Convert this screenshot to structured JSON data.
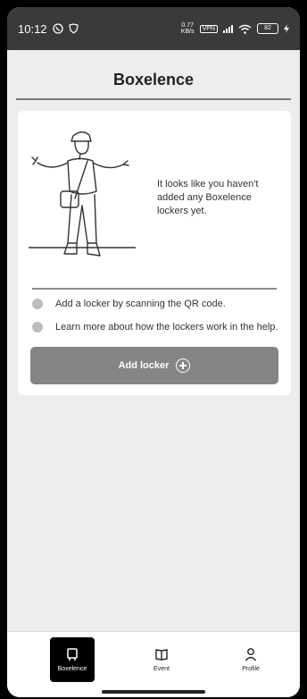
{
  "status_bar": {
    "time": "10:12",
    "speed_value": "0.77",
    "speed_unit": "KB/s",
    "vpn": "VPN",
    "battery": "82"
  },
  "header": {
    "title": "Boxelence"
  },
  "empty_state": {
    "message": "It looks like you haven't added any Boxelence lockers yet.",
    "tips": [
      "Add a locker by scanning the QR code.",
      "Learn more about how the lockers work in the help."
    ],
    "add_button_label": "Add locker"
  },
  "bottom_nav": {
    "items": [
      {
        "label": "Boxelence",
        "icon": "locker-icon",
        "active": true
      },
      {
        "label": "Event",
        "icon": "book-icon",
        "active": false
      },
      {
        "label": "Profile",
        "icon": "person-icon",
        "active": false
      }
    ]
  },
  "colors": {
    "button": "#858585",
    "active_nav": "#000000",
    "background": "#ededed"
  }
}
